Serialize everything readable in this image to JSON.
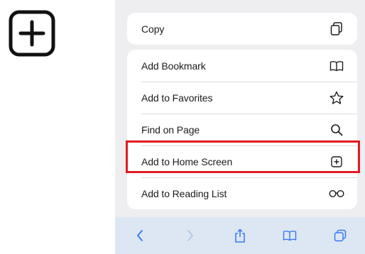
{
  "menu": {
    "copy": "Copy",
    "add_bookmark": "Add Bookmark",
    "add_to_favorites": "Add to Favorites",
    "find_on_page": "Find on Page",
    "add_to_home_screen": "Add to Home Screen",
    "add_to_reading_list": "Add to Reading List"
  },
  "icons": {
    "big_plus": "plus-square-icon",
    "copy": "copy-icon",
    "bookmark": "book-icon",
    "favorites": "star-icon",
    "find": "magnifier-icon",
    "home_screen": "plus-square-icon",
    "reading_list": "glasses-icon"
  },
  "toolbar": {
    "items": [
      "back",
      "forward",
      "share",
      "bookmarks",
      "tabs"
    ]
  },
  "colors": {
    "highlight": "#e01b24",
    "accent": "#3478f6",
    "sheet_background": "#eeeef1",
    "toolbar_background": "#dde7f3"
  }
}
